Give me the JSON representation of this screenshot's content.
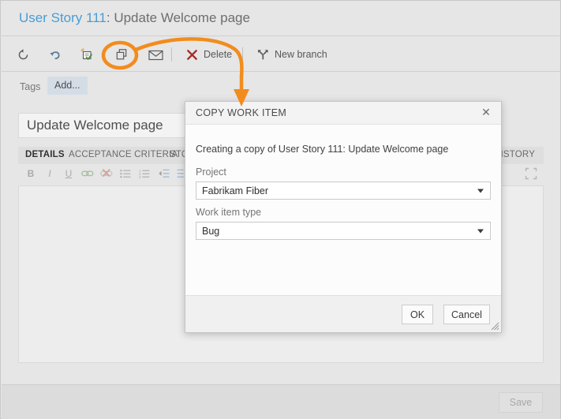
{
  "header": {
    "work_item_id": "User Story 111",
    "separator": ": ",
    "work_item_title": "Update Welcome page"
  },
  "toolbar": {
    "refresh_icon": "refresh-icon",
    "undo_icon": "undo-icon",
    "revert_icon": "revert-icon",
    "copy_icon": "copy-icon",
    "email_icon": "email-icon",
    "delete_icon": "delete-x-icon",
    "delete_label": "Delete",
    "branch_icon": "new-branch-icon",
    "branch_label": "New branch"
  },
  "tags": {
    "label": "Tags",
    "add_label": "Add..."
  },
  "title_field": {
    "value": "Update Welcome page"
  },
  "tabs": [
    {
      "label": "DETAILS",
      "active": true
    },
    {
      "label": "ACCEPTANCE CRITERIA",
      "active": false
    },
    {
      "label": "STO",
      "active": false
    },
    {
      "label": "HISTORY",
      "active": false
    }
  ],
  "editor": {
    "buttons": [
      {
        "name": "bold-icon",
        "glyph": "B"
      },
      {
        "name": "italic-icon",
        "glyph": "I"
      },
      {
        "name": "underline-icon",
        "glyph": "U"
      },
      {
        "name": "insert-link-icon",
        "glyph": "⚭"
      },
      {
        "name": "remove-link-icon",
        "glyph": "⚭"
      },
      {
        "name": "bullet-list-icon",
        "glyph": "☰"
      },
      {
        "name": "numbered-list-icon",
        "glyph": "☰"
      },
      {
        "name": "outdent-icon",
        "glyph": "⇤"
      },
      {
        "name": "indent-icon",
        "glyph": "⇥"
      },
      {
        "name": "insert-image-icon",
        "glyph": "▣"
      }
    ],
    "maximize_icon": "maximize-icon"
  },
  "bottom_bar": {
    "save_label": "Save"
  },
  "dialog": {
    "title": "COPY WORK ITEM",
    "close_icon": "close-icon",
    "description": "Creating a copy of User Story 111: Update Welcome page",
    "project_label": "Project",
    "project_value": "Fabrikam Fiber",
    "work_item_type_label": "Work item type",
    "work_item_type_value": "Bug",
    "ok_label": "OK",
    "cancel_label": "Cancel",
    "resize_grip_icon": "resize-grip-icon"
  },
  "annotation": {
    "color": "#F28C1E",
    "highlight_target": "copy-icon",
    "arrow_points_to": "COPY WORK ITEM"
  },
  "colors": {
    "accent_link": "#4a9cd6",
    "annotation_orange": "#F28C1E",
    "delete_red": "#A82A2A",
    "page_bg": "#e6e6e6",
    "dialog_bg": "#fcfcfc",
    "tag_chip": "#d4dde6"
  }
}
